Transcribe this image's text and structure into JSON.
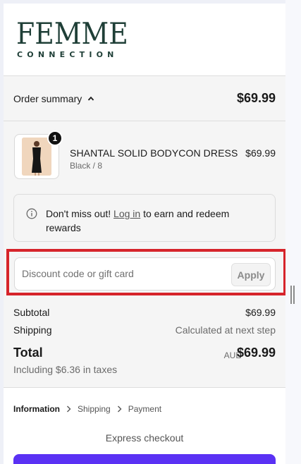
{
  "brand": {
    "logo_word": "FEMME",
    "logo_sub": "CONNECTION",
    "color": "#1f3f37"
  },
  "summary": {
    "toggle_label": "Order summary",
    "total": "$69.99"
  },
  "item": {
    "name": "SHANTAL SOLID BODYCON DRESS",
    "variant": "Black / 8",
    "price": "$69.99",
    "quantity": "1"
  },
  "notice": {
    "lead": "Don't miss out! ",
    "link": "Log in",
    "tail": " to earn and redeem rewards"
  },
  "discount": {
    "placeholder": "Discount code or gift card",
    "apply_label": "Apply"
  },
  "totals": {
    "subtotal_label": "Subtotal",
    "subtotal_value": "$69.99",
    "shipping_label": "Shipping",
    "shipping_value": "Calculated at next step",
    "total_label": "Total",
    "currency": "AUD",
    "total_value": "$69.99",
    "tax_note": "Including $6.36 in taxes"
  },
  "breadcrumb": {
    "steps": [
      "Information",
      "Shipping",
      "Payment"
    ]
  },
  "express": {
    "label": "Express checkout",
    "button_color": "#5a31f4"
  },
  "colors": {
    "highlight": "#d6242b"
  }
}
